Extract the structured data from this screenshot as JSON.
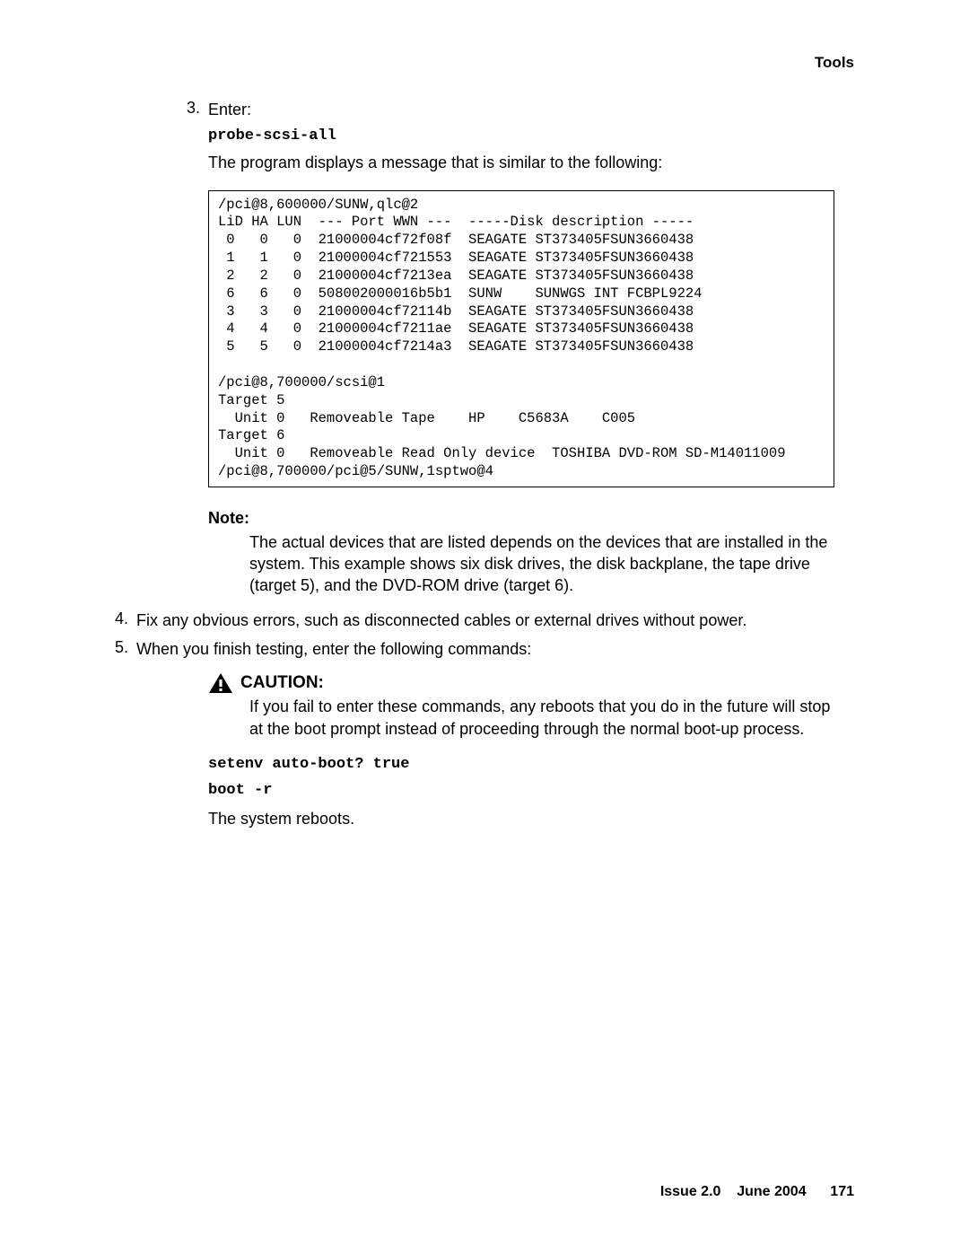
{
  "header": {
    "tools": "Tools"
  },
  "step3": {
    "num": "3.",
    "label": "Enter:",
    "command": "probe-scsi-all",
    "desc": "The program displays a message that is similar to the following:"
  },
  "code_output": "/pci@8,600000/SUNW,qlc@2\nLiD HA LUN  --- Port WWN ---  -----Disk description -----\n 0   0   0  21000004cf72f08f  SEAGATE ST373405FSUN3660438\n 1   1   0  21000004cf721553  SEAGATE ST373405FSUN3660438\n 2   2   0  21000004cf7213ea  SEAGATE ST373405FSUN3660438\n 6   6   0  508002000016b5b1  SUNW    SUNWGS INT FCBPL9224\n 3   3   0  21000004cf72114b  SEAGATE ST373405FSUN3660438\n 4   4   0  21000004cf7211ae  SEAGATE ST373405FSUN3660438\n 5   5   0  21000004cf7214a3  SEAGATE ST373405FSUN3660438\n\n/pci@8,700000/scsi@1\nTarget 5\n  Unit 0   Removeable Tape    HP    C5683A    C005\nTarget 6\n  Unit 0   Removeable Read Only device  TOSHIBA DVD-ROM SD-M14011009\n/pci@8,700000/pci@5/SUNW,1sptwo@4",
  "note": {
    "label": "Note:",
    "body": "The actual devices that are listed depends on the devices that are installed in the system. This example shows six disk drives, the disk backplane, the tape drive (target 5), and the DVD-ROM drive (target 6)."
  },
  "step4": {
    "num": "4.",
    "text": "Fix any obvious errors, such as disconnected cables or external drives without power."
  },
  "step5": {
    "num": "5.",
    "text": "When you finish testing, enter the following commands:"
  },
  "caution": {
    "label": "CAUTION:",
    "body": "If you fail to enter these commands, any reboots that you do in the future will stop at the boot prompt instead of proceeding through the normal boot-up process."
  },
  "commands": {
    "setenv": "setenv auto-boot? true",
    "boot": "boot -r"
  },
  "reboot_text": "The system reboots.",
  "footer": {
    "issue": "Issue 2.0",
    "date": "June 2004",
    "page": "171"
  }
}
